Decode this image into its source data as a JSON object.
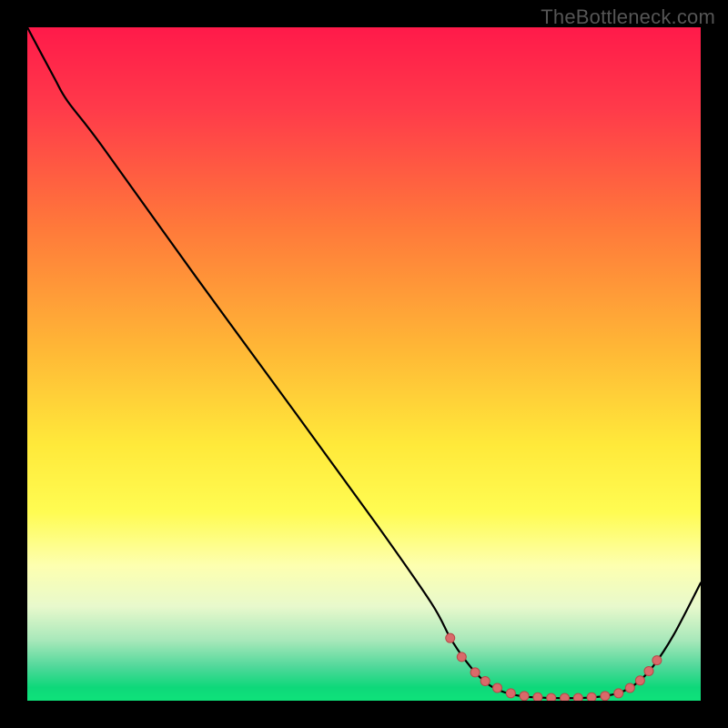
{
  "watermark": "TheBottleneck.com",
  "chart_data": {
    "type": "line",
    "title": "",
    "xlabel": "",
    "ylabel": "",
    "xlim": [
      0,
      100
    ],
    "ylim": [
      0,
      100
    ],
    "background_gradient": {
      "stops": [
        {
          "offset": 0,
          "color": "#ff1a4a"
        },
        {
          "offset": 12,
          "color": "#ff3a4a"
        },
        {
          "offset": 30,
          "color": "#ff7a3a"
        },
        {
          "offset": 48,
          "color": "#ffb836"
        },
        {
          "offset": 62,
          "color": "#ffe93a"
        },
        {
          "offset": 72,
          "color": "#fffc52"
        },
        {
          "offset": 80,
          "color": "#fdffb0"
        },
        {
          "offset": 86,
          "color": "#e8f9cc"
        },
        {
          "offset": 91,
          "color": "#a8e8ba"
        },
        {
          "offset": 95,
          "color": "#4fd89a"
        },
        {
          "offset": 98,
          "color": "#0ed87a"
        },
        {
          "offset": 100,
          "color": "#0ee27a"
        }
      ]
    },
    "curve": {
      "name": "bottleneck-curve",
      "color": "#000000",
      "width": 2.2,
      "points": [
        {
          "x": 0.0,
          "y": 100.0
        },
        {
          "x": 4.0,
          "y": 92.5
        },
        {
          "x": 6.0,
          "y": 89.0
        },
        {
          "x": 11.0,
          "y": 82.5
        },
        {
          "x": 25.0,
          "y": 63.0
        },
        {
          "x": 40.0,
          "y": 42.5
        },
        {
          "x": 52.0,
          "y": 26.0
        },
        {
          "x": 60.0,
          "y": 14.5
        },
        {
          "x": 63.0,
          "y": 9.0
        },
        {
          "x": 66.0,
          "y": 4.8
        },
        {
          "x": 68.5,
          "y": 2.4
        },
        {
          "x": 71.0,
          "y": 1.2
        },
        {
          "x": 74.0,
          "y": 0.6
        },
        {
          "x": 78.0,
          "y": 0.4
        },
        {
          "x": 82.0,
          "y": 0.4
        },
        {
          "x": 85.0,
          "y": 0.6
        },
        {
          "x": 88.0,
          "y": 1.2
        },
        {
          "x": 90.5,
          "y": 2.6
        },
        {
          "x": 93.0,
          "y": 5.2
        },
        {
          "x": 96.0,
          "y": 9.8
        },
        {
          "x": 100.0,
          "y": 17.5
        }
      ]
    },
    "markers": {
      "name": "curve-markers",
      "color": "#d96a6a",
      "stroke": "#b84848",
      "radius": 5.0,
      "points": [
        {
          "x": 62.8,
          "y": 9.3
        },
        {
          "x": 64.5,
          "y": 6.5
        },
        {
          "x": 66.5,
          "y": 4.2
        },
        {
          "x": 68.0,
          "y": 2.9
        },
        {
          "x": 69.8,
          "y": 1.9
        },
        {
          "x": 71.8,
          "y": 1.1
        },
        {
          "x": 73.8,
          "y": 0.7
        },
        {
          "x": 75.8,
          "y": 0.5
        },
        {
          "x": 77.8,
          "y": 0.4
        },
        {
          "x": 79.8,
          "y": 0.4
        },
        {
          "x": 81.8,
          "y": 0.4
        },
        {
          "x": 83.8,
          "y": 0.5
        },
        {
          "x": 85.8,
          "y": 0.7
        },
        {
          "x": 87.8,
          "y": 1.1
        },
        {
          "x": 89.5,
          "y": 1.9
        },
        {
          "x": 91.0,
          "y": 3.0
        },
        {
          "x": 92.3,
          "y": 4.4
        },
        {
          "x": 93.5,
          "y": 6.0
        }
      ]
    }
  }
}
